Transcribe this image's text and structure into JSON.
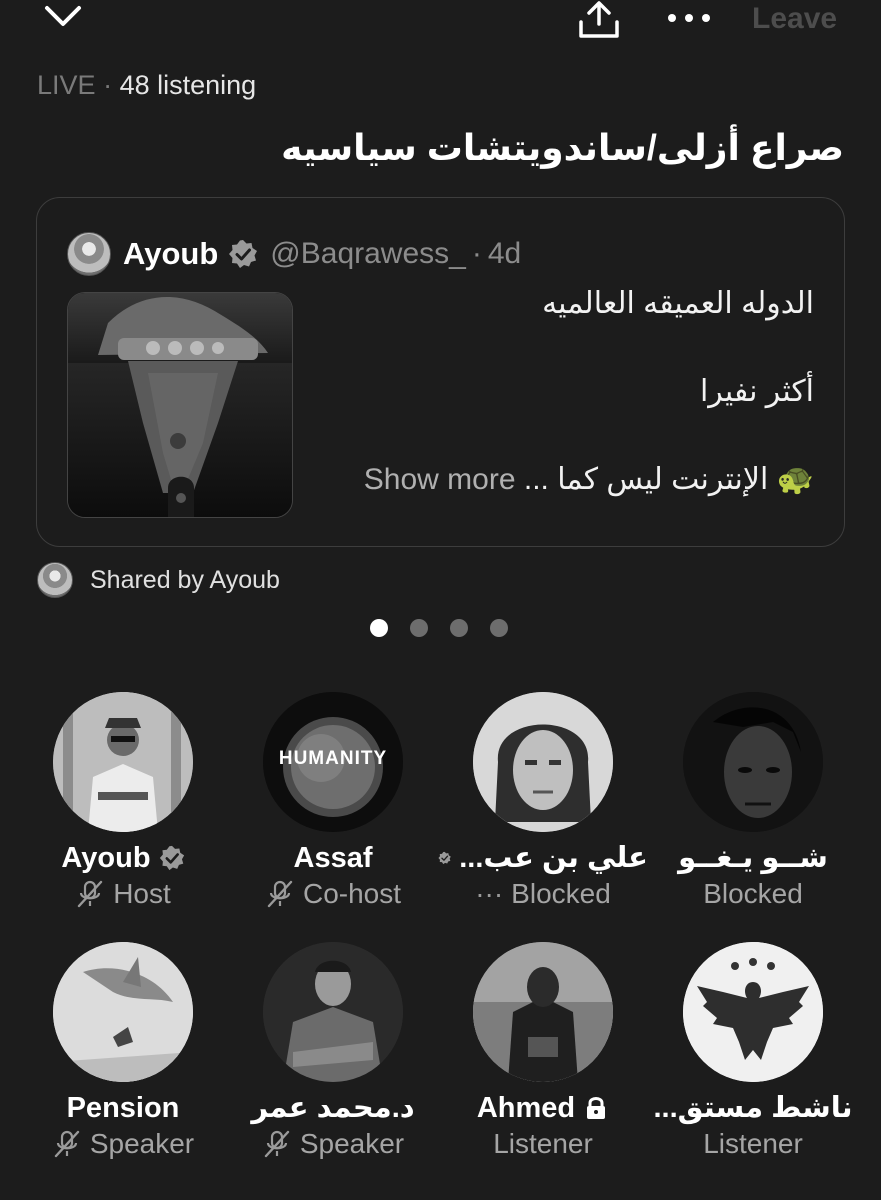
{
  "topbar": {
    "collapse_icon": "chevron-down-icon",
    "share_icon": "share-upload-icon",
    "more_icon": "more-horizontal-icon",
    "leave_label": "Leave"
  },
  "space": {
    "live_label": "LIVE",
    "separator": "·",
    "listening": "48 listening",
    "title": "صراع أزلى/ساندويتشات سياسيه"
  },
  "pinned_post": {
    "author": "Ayoub",
    "handle": "@Baqrawess_",
    "separator": "·",
    "age": "4d",
    "line1": "الدوله العميقه العالميه",
    "line2": "أكثر نفيرا",
    "line3": "🐢 الإنترنت ليس كما ...",
    "show_more": "Show more"
  },
  "shared_by": "Shared by Ayoub",
  "pager": {
    "count": 4,
    "active": 0
  },
  "participants": [
    {
      "name": "Ayoub",
      "verified": true,
      "locked": false,
      "role": "Host",
      "mic_off": true,
      "menu": false
    },
    {
      "name": "Assaf",
      "verified": false,
      "locked": false,
      "role": "Co-host",
      "mic_off": true,
      "menu": false
    },
    {
      "name": "علي بن عب...",
      "verified": true,
      "locked": false,
      "role": "Blocked",
      "mic_off": false,
      "menu": true,
      "menu_glyph": "···"
    },
    {
      "name": "شــو يـغــو",
      "verified": false,
      "locked": false,
      "role": "Blocked",
      "mic_off": false,
      "menu": false
    },
    {
      "name": "Pension",
      "verified": false,
      "locked": false,
      "role": "Speaker",
      "mic_off": true,
      "menu": false
    },
    {
      "name": "د.محمد عمر",
      "verified": false,
      "locked": false,
      "role": "Speaker",
      "mic_off": true,
      "menu": false
    },
    {
      "name": "Ahmed",
      "verified": false,
      "locked": true,
      "role": "Listener",
      "mic_off": false,
      "menu": false
    },
    {
      "name": "ناشط مستق...",
      "verified": false,
      "locked": false,
      "role": "Listener",
      "mic_off": false,
      "menu": false
    }
  ],
  "avatar_texts": {
    "humanity": "HUMANITY"
  }
}
